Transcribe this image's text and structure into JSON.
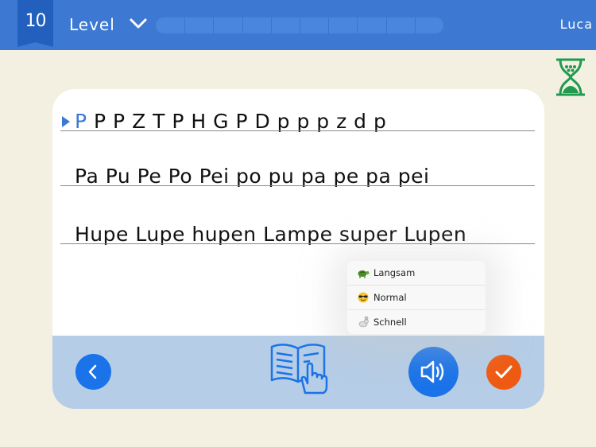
{
  "header": {
    "level_number": "10",
    "level_label": "Level",
    "progress": 0.0,
    "progress_segments": 10,
    "user_name": "Luca"
  },
  "lines": [
    {
      "active_letter": "P",
      "rest": " P P Z T P H G P D p p p z d p"
    },
    {
      "text": "Pa Pu Pe Po Pei po pu pa pe pa pei"
    },
    {
      "text": "Hupe Lupe hupen Lampe super Lupen"
    }
  ],
  "speed_menu": {
    "items": [
      {
        "label": "Langsam",
        "icon": "turtle-icon"
      },
      {
        "label": "Normal",
        "icon": "sunglasses-face-icon"
      },
      {
        "label": "Schnell",
        "icon": "rabbit-icon"
      }
    ]
  },
  "colors": {
    "header_blue": "#3d79d3",
    "button_blue": "#1a73e8",
    "check_orange": "#ef5a12",
    "footer": "#b5cde6",
    "background": "#f3f0e1",
    "hourglass_green": "#1f9a4f"
  },
  "icons": {
    "chevron": "chevron-down-icon",
    "timer": "hourglass-icon",
    "back": "chevron-left-icon",
    "read": "book-pointer-icon",
    "audio": "speaker-icon",
    "confirm": "checkmark-icon"
  }
}
